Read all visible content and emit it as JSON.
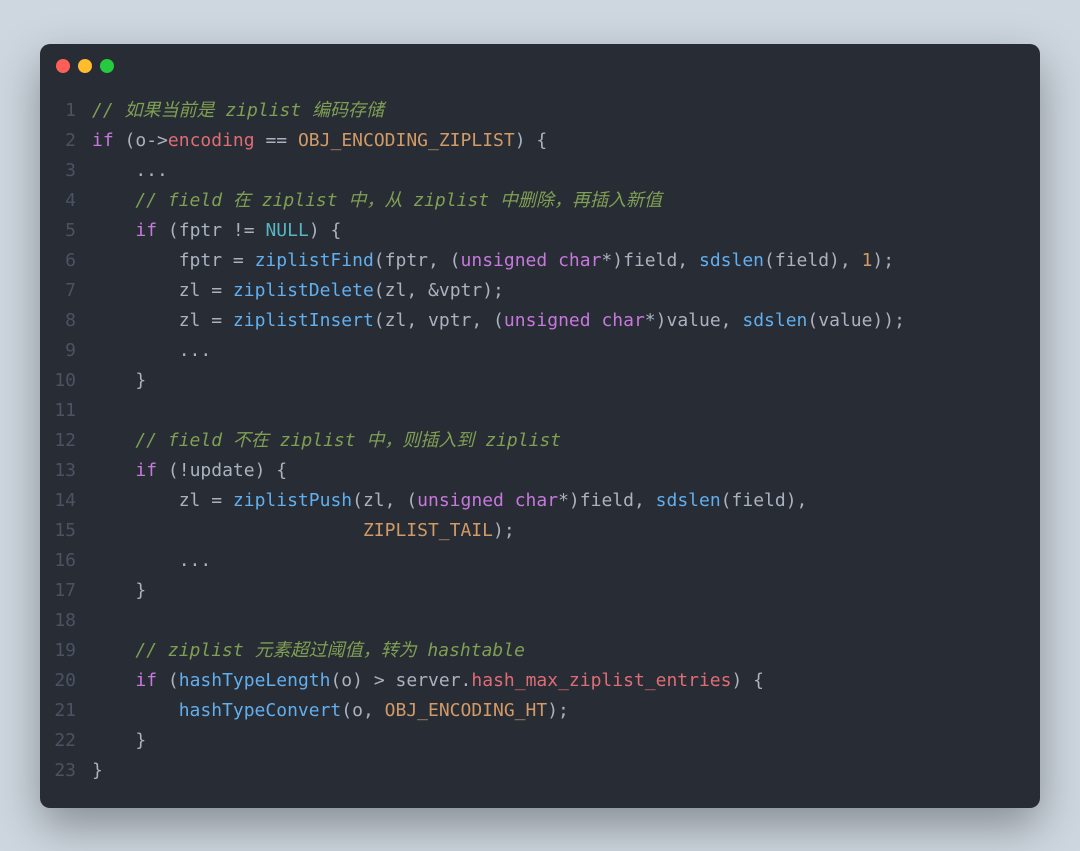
{
  "window": {
    "traffic": [
      "close",
      "minimize",
      "zoom"
    ]
  },
  "code": {
    "lines": [
      {
        "n": 1,
        "tokens": [
          [
            "comment",
            "// 如果当前是 ziplist 编码存储"
          ]
        ]
      },
      {
        "n": 2,
        "tokens": [
          [
            "key",
            "if"
          ],
          [
            "punct",
            " ("
          ],
          [
            "ident",
            "o"
          ],
          [
            "op",
            "->"
          ],
          [
            "field",
            "encoding"
          ],
          [
            "op",
            " == "
          ],
          [
            "macro",
            "OBJ_ENCODING_ZIPLIST"
          ],
          [
            "punct",
            ") {"
          ]
        ]
      },
      {
        "n": 3,
        "tokens": [
          [
            "punct",
            "    ..."
          ]
        ]
      },
      {
        "n": 4,
        "tokens": [
          [
            "punct",
            "    "
          ],
          [
            "comment",
            "// field 在 ziplist 中，从 ziplist 中删除，再插入新值"
          ]
        ]
      },
      {
        "n": 5,
        "tokens": [
          [
            "punct",
            "    "
          ],
          [
            "key",
            "if"
          ],
          [
            "punct",
            " ("
          ],
          [
            "ident",
            "fptr"
          ],
          [
            "op",
            " != "
          ],
          [
            "const",
            "NULL"
          ],
          [
            "punct",
            ") {"
          ]
        ]
      },
      {
        "n": 6,
        "tokens": [
          [
            "punct",
            "        "
          ],
          [
            "ident",
            "fptr"
          ],
          [
            "op",
            " = "
          ],
          [
            "func",
            "ziplistFind"
          ],
          [
            "punct",
            "("
          ],
          [
            "ident",
            "fptr"
          ],
          [
            "punct",
            ", ("
          ],
          [
            "type",
            "unsigned"
          ],
          [
            "punct",
            " "
          ],
          [
            "type",
            "char"
          ],
          [
            "op",
            "*"
          ],
          [
            "punct",
            ")"
          ],
          [
            "ident",
            "field"
          ],
          [
            "punct",
            ", "
          ],
          [
            "func",
            "sdslen"
          ],
          [
            "punct",
            "("
          ],
          [
            "ident",
            "field"
          ],
          [
            "punct",
            "), "
          ],
          [
            "num",
            "1"
          ],
          [
            "punct",
            ");"
          ]
        ]
      },
      {
        "n": 7,
        "tokens": [
          [
            "punct",
            "        "
          ],
          [
            "ident",
            "zl"
          ],
          [
            "op",
            " = "
          ],
          [
            "func",
            "ziplistDelete"
          ],
          [
            "punct",
            "("
          ],
          [
            "ident",
            "zl"
          ],
          [
            "punct",
            ", "
          ],
          [
            "amp",
            "&"
          ],
          [
            "ident",
            "vptr"
          ],
          [
            "punct",
            ");"
          ]
        ]
      },
      {
        "n": 8,
        "tokens": [
          [
            "punct",
            "        "
          ],
          [
            "ident",
            "zl"
          ],
          [
            "op",
            " = "
          ],
          [
            "func",
            "ziplistInsert"
          ],
          [
            "punct",
            "("
          ],
          [
            "ident",
            "zl"
          ],
          [
            "punct",
            ", "
          ],
          [
            "ident",
            "vptr"
          ],
          [
            "punct",
            ", ("
          ],
          [
            "type",
            "unsigned"
          ],
          [
            "punct",
            " "
          ],
          [
            "type",
            "char"
          ],
          [
            "op",
            "*"
          ],
          [
            "punct",
            ")"
          ],
          [
            "ident",
            "value"
          ],
          [
            "punct",
            ", "
          ],
          [
            "func",
            "sdslen"
          ],
          [
            "punct",
            "("
          ],
          [
            "ident",
            "value"
          ],
          [
            "punct",
            "));"
          ]
        ]
      },
      {
        "n": 9,
        "tokens": [
          [
            "punct",
            "        ..."
          ]
        ]
      },
      {
        "n": 10,
        "tokens": [
          [
            "punct",
            "    }"
          ]
        ]
      },
      {
        "n": 11,
        "tokens": [
          [
            "punct",
            ""
          ]
        ]
      },
      {
        "n": 12,
        "tokens": [
          [
            "punct",
            "    "
          ],
          [
            "comment",
            "// field 不在 ziplist 中，则插入到 ziplist"
          ]
        ]
      },
      {
        "n": 13,
        "tokens": [
          [
            "punct",
            "    "
          ],
          [
            "key",
            "if"
          ],
          [
            "punct",
            " ("
          ],
          [
            "op",
            "!"
          ],
          [
            "ident",
            "update"
          ],
          [
            "punct",
            ") {"
          ]
        ]
      },
      {
        "n": 14,
        "tokens": [
          [
            "punct",
            "        "
          ],
          [
            "ident",
            "zl"
          ],
          [
            "op",
            " = "
          ],
          [
            "func",
            "ziplistPush"
          ],
          [
            "punct",
            "("
          ],
          [
            "ident",
            "zl"
          ],
          [
            "punct",
            ", ("
          ],
          [
            "type",
            "unsigned"
          ],
          [
            "punct",
            " "
          ],
          [
            "type",
            "char"
          ],
          [
            "op",
            "*"
          ],
          [
            "punct",
            ")"
          ],
          [
            "ident",
            "field"
          ],
          [
            "punct",
            ", "
          ],
          [
            "func",
            "sdslen"
          ],
          [
            "punct",
            "("
          ],
          [
            "ident",
            "field"
          ],
          [
            "punct",
            "),"
          ]
        ]
      },
      {
        "n": 15,
        "tokens": [
          [
            "punct",
            "                         "
          ],
          [
            "macro",
            "ZIPLIST_TAIL"
          ],
          [
            "punct",
            ");"
          ]
        ]
      },
      {
        "n": 16,
        "tokens": [
          [
            "punct",
            "        ..."
          ]
        ]
      },
      {
        "n": 17,
        "tokens": [
          [
            "punct",
            "    }"
          ]
        ]
      },
      {
        "n": 18,
        "tokens": [
          [
            "punct",
            ""
          ]
        ]
      },
      {
        "n": 19,
        "tokens": [
          [
            "punct",
            "    "
          ],
          [
            "comment",
            "// ziplist 元素超过阈值，转为 hashtable"
          ]
        ]
      },
      {
        "n": 20,
        "tokens": [
          [
            "punct",
            "    "
          ],
          [
            "key",
            "if"
          ],
          [
            "punct",
            " ("
          ],
          [
            "func",
            "hashTypeLength"
          ],
          [
            "punct",
            "("
          ],
          [
            "ident",
            "o"
          ],
          [
            "punct",
            ") "
          ],
          [
            "op",
            ">"
          ],
          [
            "punct",
            " "
          ],
          [
            "ident",
            "server"
          ],
          [
            "punct",
            "."
          ],
          [
            "field",
            "hash_max_ziplist_entries"
          ],
          [
            "punct",
            ") {"
          ]
        ]
      },
      {
        "n": 21,
        "tokens": [
          [
            "punct",
            "        "
          ],
          [
            "func",
            "hashTypeConvert"
          ],
          [
            "punct",
            "("
          ],
          [
            "ident",
            "o"
          ],
          [
            "punct",
            ", "
          ],
          [
            "macro",
            "OBJ_ENCODING_HT"
          ],
          [
            "punct",
            ");"
          ]
        ]
      },
      {
        "n": 22,
        "tokens": [
          [
            "punct",
            "    }"
          ]
        ]
      },
      {
        "n": 23,
        "tokens": [
          [
            "punct",
            "}"
          ]
        ]
      }
    ]
  }
}
